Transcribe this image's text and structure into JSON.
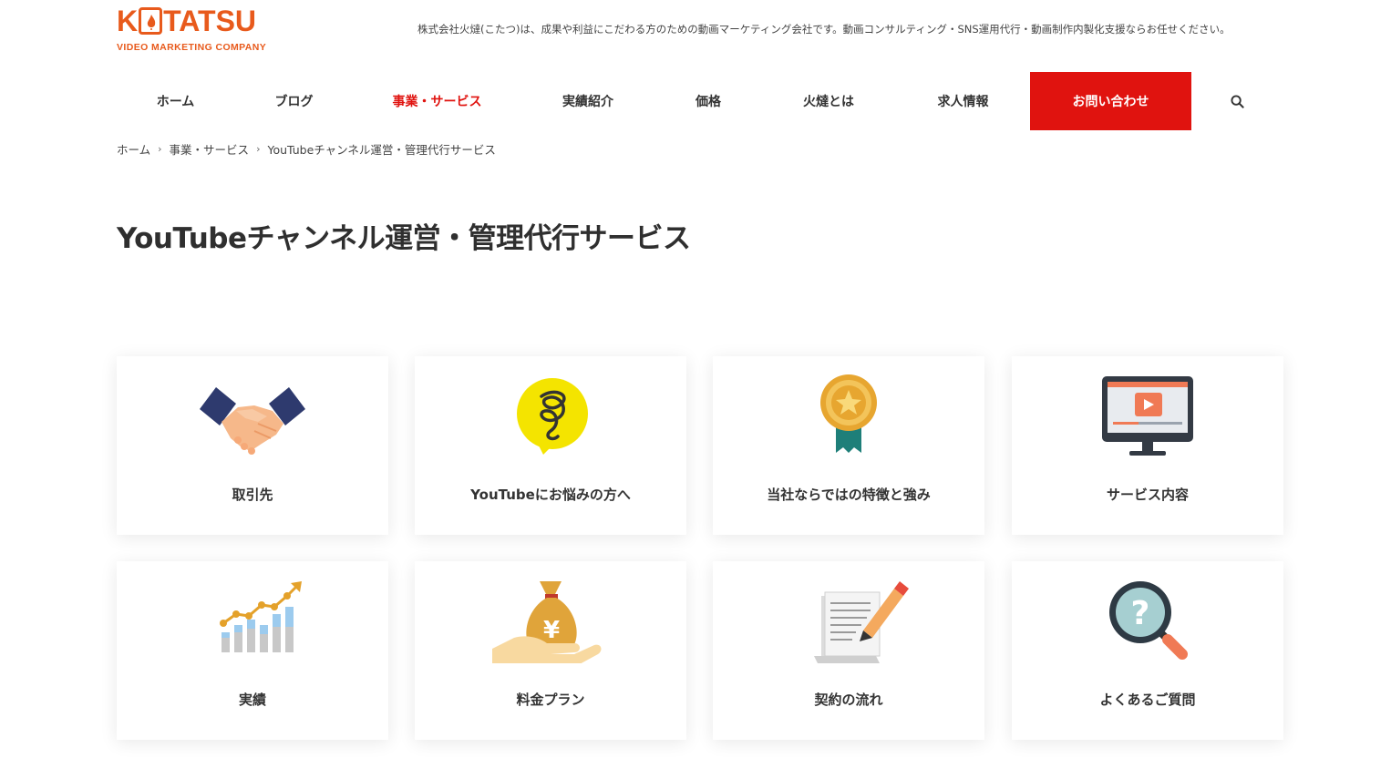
{
  "header": {
    "logo_k": "K",
    "logo_rest": "TATSU",
    "logo_sub": "VIDEO MARKETING COMPANY",
    "tagline": "株式会社火燵(こたつ)は、成果や利益にこだわる方のための動画マーケティング会社です。動画コンサルティング・SNS運用代行・動画制作内製化支援ならお任せください。"
  },
  "nav": {
    "items": [
      "ホーム",
      "ブログ",
      "事業・サービス",
      "実績紹介",
      "価格",
      "火燵とは",
      "求人情報"
    ],
    "active_index": 2,
    "cta": "お問い合わせ",
    "search_icon": "search-icon"
  },
  "breadcrumb": [
    "ホーム",
    "事業・サービス",
    "YouTubeチャンネル運営・管理代行サービス"
  ],
  "page_title": "YouTubeチャンネル運営・管理代行サービス",
  "cards": [
    {
      "label": "取引先",
      "icon": "handshake-icon"
    },
    {
      "label": "YouTubeにお悩みの方へ",
      "icon": "worry-bubble-icon"
    },
    {
      "label": "当社ならではの特徴と強み",
      "icon": "award-badge-icon"
    },
    {
      "label": "サービス内容",
      "icon": "video-monitor-icon"
    },
    {
      "label": "実績",
      "icon": "growth-chart-icon"
    },
    {
      "label": "料金プラン",
      "icon": "money-bag-icon"
    },
    {
      "label": "契約の流れ",
      "icon": "contract-pen-icon"
    },
    {
      "label": "よくあるご質問",
      "icon": "question-magnifier-icon"
    }
  ],
  "colors": {
    "brand": "#e85a1c",
    "accent": "#e0130f",
    "text": "#333333"
  }
}
